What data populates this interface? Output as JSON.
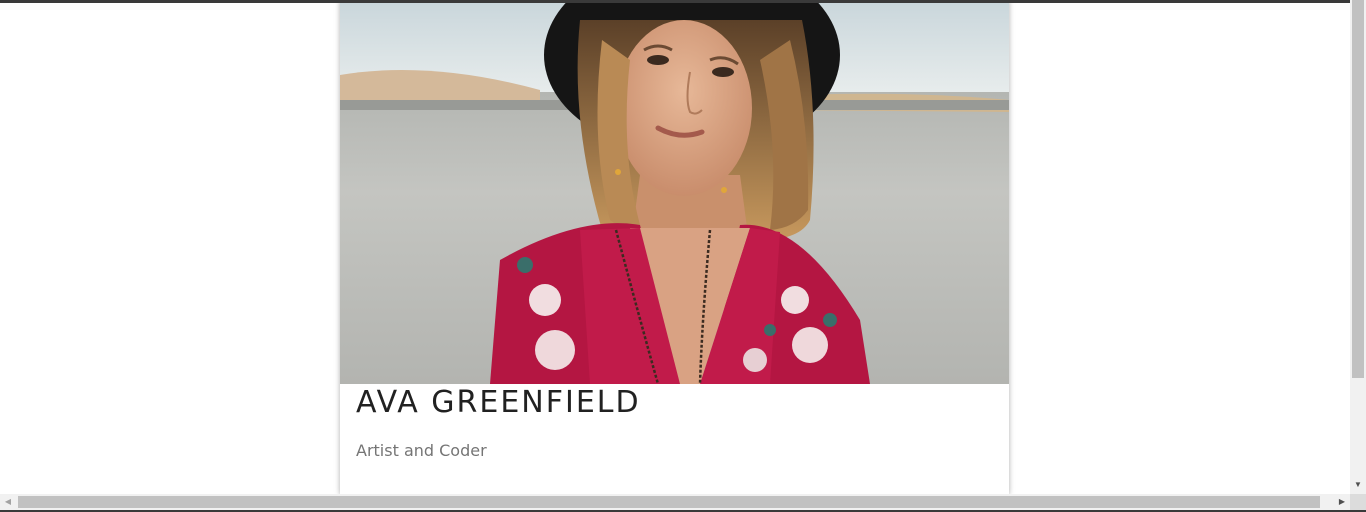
{
  "profile": {
    "name": "AVA GREENFIELD",
    "subtitle": "Artist and Coder"
  },
  "colors": {
    "page_background": "#ffffff",
    "name_text": "#212121",
    "subtitle_text": "#757575",
    "scrollbar_track": "#f1f1f1",
    "scrollbar_thumb": "#c1c1c1"
  },
  "scrollbars": {
    "down_arrow": "▼",
    "left_arrow": "◀",
    "right_arrow": "▶"
  }
}
